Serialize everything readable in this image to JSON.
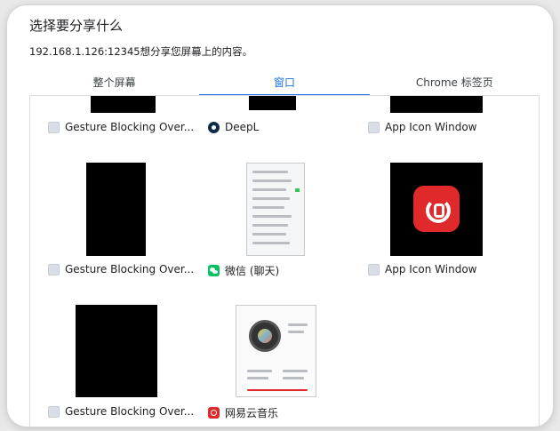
{
  "dialog": {
    "title": "选择要分享什么",
    "subtitle": "192.168.1.126:12345想分享您屏幕上的内容。"
  },
  "tabs": [
    {
      "label": "整个屏幕",
      "active": false
    },
    {
      "label": "窗口",
      "active": true
    },
    {
      "label": "Chrome 标签页",
      "active": false
    }
  ],
  "windows": [
    {
      "label": "Gesture Blocking Over...",
      "icon": "placeholder-icon"
    },
    {
      "label": "DeepL",
      "icon": "deepl-icon"
    },
    {
      "label": "App Icon Window",
      "icon": "placeholder-icon"
    },
    {
      "label": "Gesture Blocking Over...",
      "icon": "placeholder-icon"
    },
    {
      "label": "微信 (聊天)",
      "icon": "wechat-icon"
    },
    {
      "label": "App Icon Window",
      "icon": "placeholder-icon"
    },
    {
      "label": "Gesture Blocking Over...",
      "icon": "placeholder-icon"
    },
    {
      "label": "网易云音乐",
      "icon": "netease-music-icon"
    }
  ],
  "colors": {
    "accent": "#1a73e8",
    "wechat": "#07c160",
    "netease": "#e0292b"
  }
}
